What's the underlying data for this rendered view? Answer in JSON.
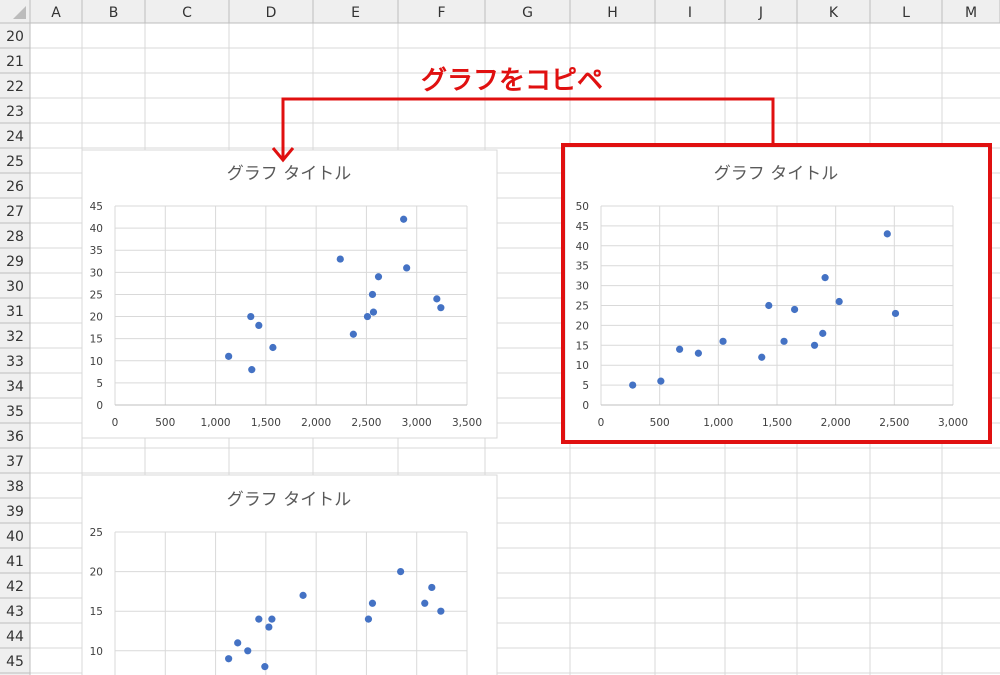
{
  "spreadsheet": {
    "columns": [
      "A",
      "B",
      "C",
      "D",
      "E",
      "F",
      "G",
      "H",
      "I",
      "J",
      "K",
      "L",
      "M"
    ],
    "rows": [
      "20",
      "21",
      "22",
      "23",
      "24",
      "25",
      "26",
      "27",
      "28",
      "29",
      "30",
      "31",
      "32",
      "33",
      "34",
      "35",
      "36",
      "37",
      "38",
      "39",
      "40",
      "41",
      "42",
      "43",
      "44",
      "45"
    ]
  },
  "annotation": {
    "label": "グラフをコピペ",
    "color": "#e01010"
  },
  "chart_data": [
    {
      "type": "scatter",
      "title": "グラフ タイトル",
      "xlim": [
        0,
        3500
      ],
      "ylim": [
        0,
        45
      ],
      "xticks": [
        0,
        500,
        1000,
        1500,
        2000,
        2500,
        3000,
        3500
      ],
      "xtick_labels": [
        "0",
        "500",
        "1,000",
        "1,500",
        "2,000",
        "2,500",
        "3,000",
        "3,500"
      ],
      "yticks": [
        0,
        5,
        10,
        15,
        20,
        25,
        30,
        35,
        40,
        45
      ],
      "ytick_labels": [
        "0",
        "5",
        "10",
        "15",
        "20",
        "25",
        "30",
        "35",
        "40",
        "45"
      ],
      "grid": true,
      "points": [
        {
          "x": 1130,
          "y": 11
        },
        {
          "x": 1350,
          "y": 20
        },
        {
          "x": 1360,
          "y": 8
        },
        {
          "x": 1430,
          "y": 18
        },
        {
          "x": 1570,
          "y": 13
        },
        {
          "x": 2240,
          "y": 33
        },
        {
          "x": 2370,
          "y": 16
        },
        {
          "x": 2510,
          "y": 20
        },
        {
          "x": 2560,
          "y": 25
        },
        {
          "x": 2570,
          "y": 21
        },
        {
          "x": 2620,
          "y": 29
        },
        {
          "x": 2870,
          "y": 42
        },
        {
          "x": 2900,
          "y": 31
        },
        {
          "x": 3200,
          "y": 24
        },
        {
          "x": 3240,
          "y": 22
        }
      ]
    },
    {
      "type": "scatter",
      "title": "グラフ タイトル",
      "xlim": [
        0,
        3000
      ],
      "ylim": [
        0,
        50
      ],
      "xticks": [
        0,
        500,
        1000,
        1500,
        2000,
        2500,
        3000
      ],
      "xtick_labels": [
        "0",
        "500",
        "1,000",
        "1,500",
        "2,000",
        "2,500",
        "3,000"
      ],
      "yticks": [
        0,
        5,
        10,
        15,
        20,
        25,
        30,
        35,
        40,
        45,
        50
      ],
      "ytick_labels": [
        "0",
        "5",
        "10",
        "15",
        "20",
        "25",
        "30",
        "35",
        "40",
        "45",
        "50"
      ],
      "grid": true,
      "selected": true,
      "points": [
        {
          "x": 270,
          "y": 5
        },
        {
          "x": 510,
          "y": 6
        },
        {
          "x": 670,
          "y": 14
        },
        {
          "x": 830,
          "y": 13
        },
        {
          "x": 1040,
          "y": 16
        },
        {
          "x": 1370,
          "y": 12
        },
        {
          "x": 1430,
          "y": 25
        },
        {
          "x": 1560,
          "y": 16
        },
        {
          "x": 1650,
          "y": 24
        },
        {
          "x": 1820,
          "y": 15
        },
        {
          "x": 1890,
          "y": 18
        },
        {
          "x": 1910,
          "y": 32
        },
        {
          "x": 2030,
          "y": 26
        },
        {
          "x": 2440,
          "y": 43
        },
        {
          "x": 2510,
          "y": 23
        }
      ]
    },
    {
      "type": "scatter",
      "title": "グラフ タイトル",
      "ylim": [
        0,
        25
      ],
      "yticks": [
        10,
        15,
        20,
        25
      ],
      "ytick_labels": [
        "10",
        "15",
        "20",
        "25"
      ],
      "grid": true,
      "points": [
        {
          "x": 1130,
          "y": 9
        },
        {
          "x": 1220,
          "y": 11
        },
        {
          "x": 1320,
          "y": 10
        },
        {
          "x": 1430,
          "y": 14
        },
        {
          "x": 1490,
          "y": 8
        },
        {
          "x": 1530,
          "y": 13
        },
        {
          "x": 1560,
          "y": 14
        },
        {
          "x": 1870,
          "y": 17
        },
        {
          "x": 2520,
          "y": 14
        },
        {
          "x": 2560,
          "y": 16
        },
        {
          "x": 2840,
          "y": 20
        },
        {
          "x": 3080,
          "y": 16
        },
        {
          "x": 3150,
          "y": 18
        },
        {
          "x": 3240,
          "y": 15
        }
      ]
    }
  ]
}
